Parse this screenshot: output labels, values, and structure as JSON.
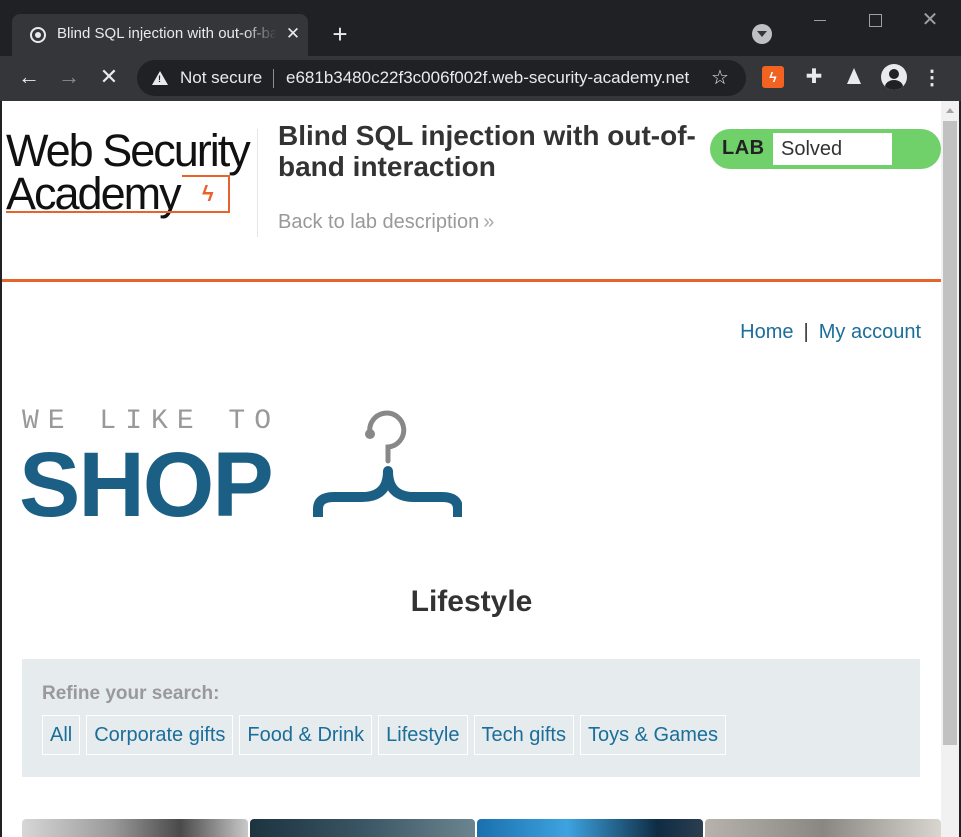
{
  "browser": {
    "tab_title": "Blind SQL injection with out-of-band interaction",
    "security_label": "Not secure",
    "url": "e681b3480c22f3c006f002f.web-security-academy.net",
    "icons": [
      "back-icon",
      "forward-icon",
      "stop-icon",
      "warning-icon",
      "star-icon",
      "extension-icon",
      "puzzle-icon",
      "labs-icon",
      "profile-icon",
      "menu-icon"
    ]
  },
  "lab_header": {
    "logo_line1": "Web Security",
    "logo_line2": "Academy",
    "title": "Blind SQL injection with out-of-band interaction",
    "back_link": "Back to lab description",
    "badge_label": "LAB",
    "badge_status": "Solved",
    "accent_color": "#e8622c",
    "solved_color": "#70d16a"
  },
  "site_nav": {
    "home": "Home",
    "separator": "|",
    "account": "My account"
  },
  "banner": {
    "small_text": "WE LIKE TO",
    "big_text": "SHOP",
    "color": "#1b5f84"
  },
  "category": {
    "heading": "Lifestyle"
  },
  "filters": {
    "title": "Refine your search:",
    "items": [
      {
        "label": "All"
      },
      {
        "label": "Corporate gifts"
      },
      {
        "label": "Food & Drink"
      },
      {
        "label": "Lifestyle"
      },
      {
        "label": "Tech gifts"
      },
      {
        "label": "Toys & Games"
      }
    ]
  }
}
